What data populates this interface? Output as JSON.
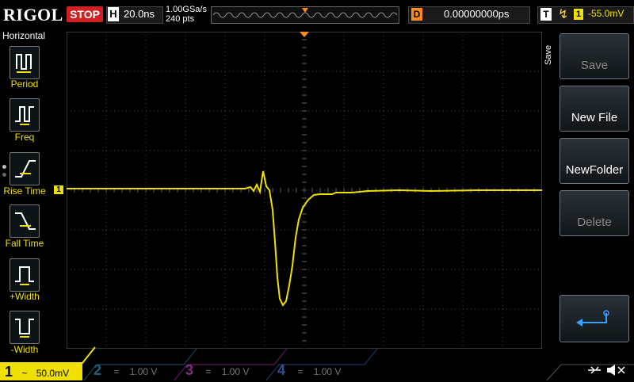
{
  "brand": "RIGOL",
  "run_status": "STOP",
  "horizontal": {
    "label": "H",
    "timebase": "20.0ns",
    "sample_rate": "1.00GSa/s",
    "points": "240 pts"
  },
  "delay": {
    "label": "D",
    "value": "0.00000000ps"
  },
  "trigger": {
    "label": "T",
    "source": "1",
    "level": "-55.0mV"
  },
  "left_menu": {
    "title": "Horizontal",
    "items": [
      "Period",
      "Freq",
      "Rise Time",
      "Fall Time",
      "+Width",
      "-Width"
    ]
  },
  "right_menu": {
    "tab": "Save",
    "buttons": [
      "Save",
      "New File",
      "NewFolder",
      "Delete"
    ]
  },
  "channels": [
    {
      "num": "1",
      "coupling": "~",
      "scale": "50.0mV",
      "color": "#f0e000"
    },
    {
      "num": "2",
      "coupling": "=",
      "scale": "1.00 V",
      "color": "#1f8fbf"
    },
    {
      "num": "3",
      "coupling": "=",
      "scale": "1.00 V",
      "color": "#c02fc0"
    },
    {
      "num": "4",
      "coupling": "=",
      "scale": "1.00 V",
      "color": "#2f6fd0"
    }
  ],
  "markers": {
    "ch1": "1",
    "trig": "T"
  },
  "colors": {
    "ch1": "#f0e000",
    "grid": "#4a4a4a",
    "accent": "#ff8c1a"
  }
}
